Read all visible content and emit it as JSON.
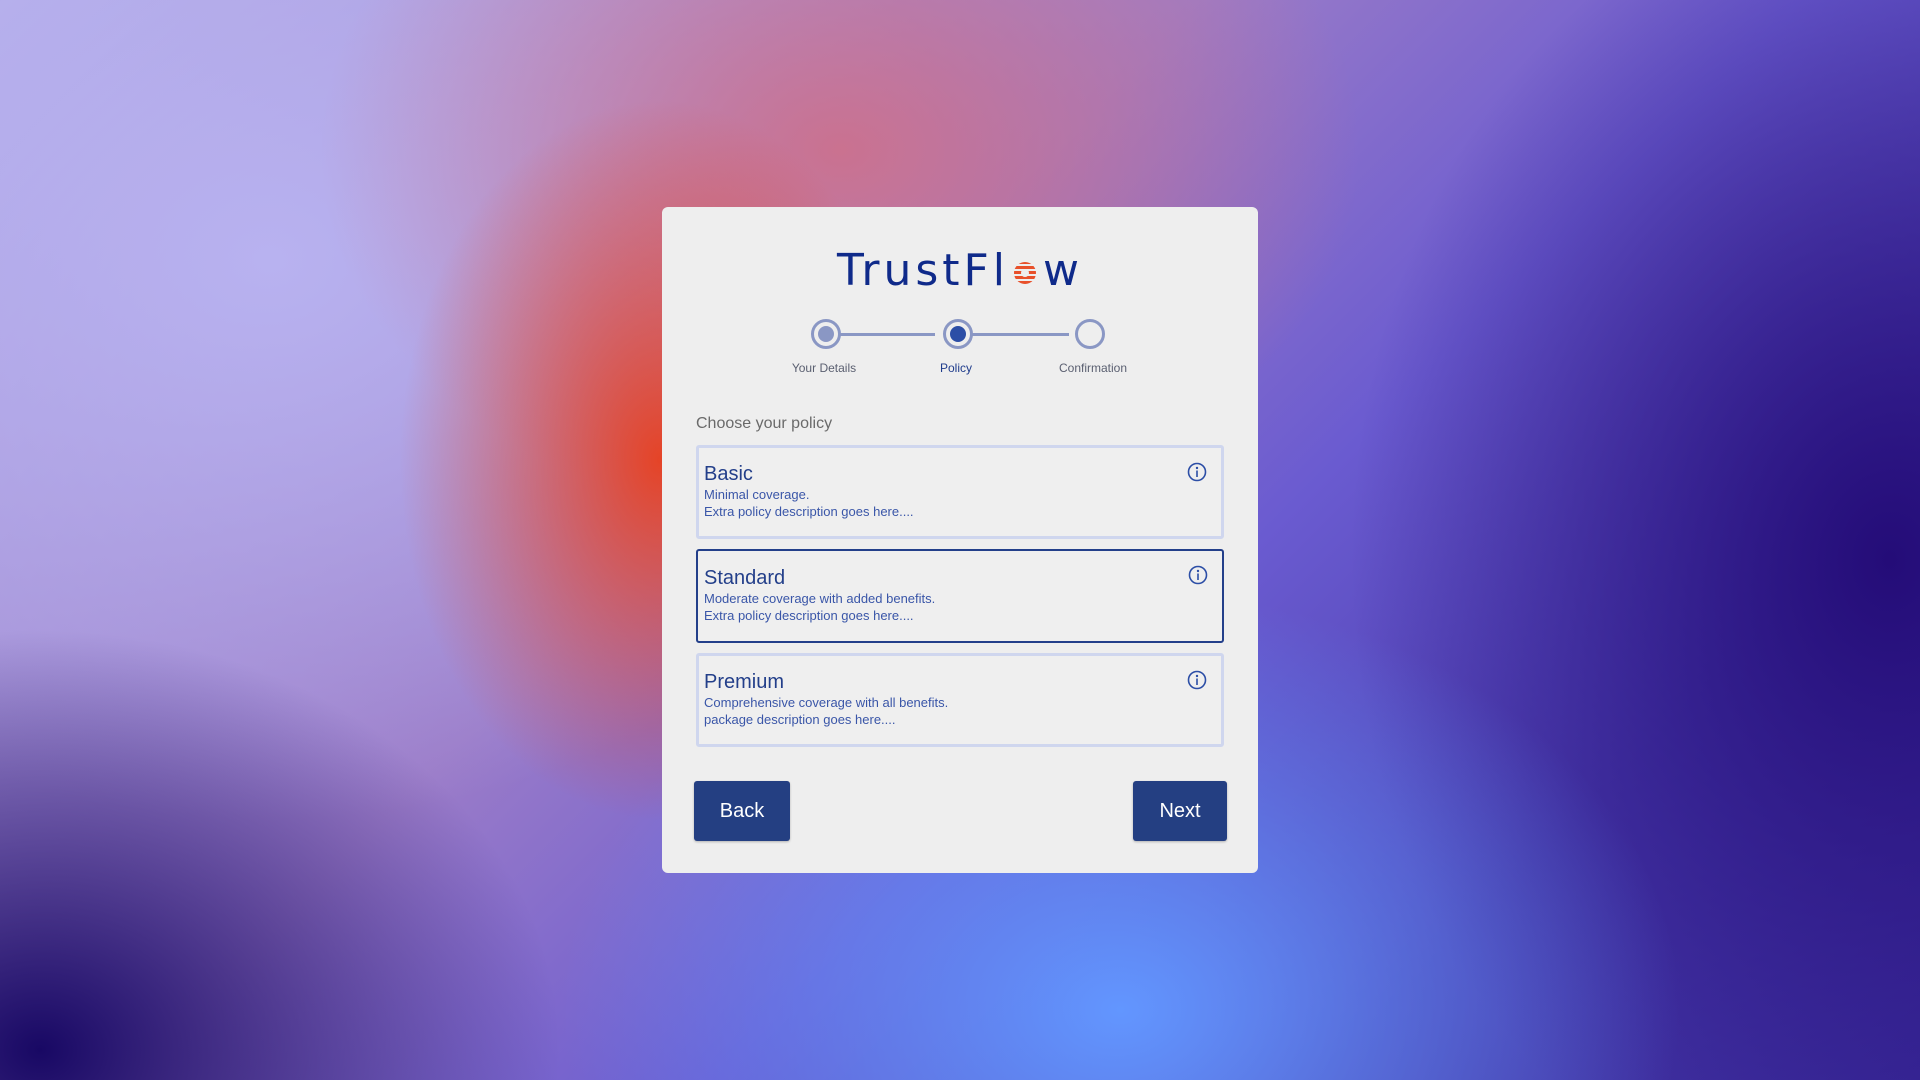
{
  "brand": {
    "before": "TrustFl",
    "after": "w",
    "mark_icon": "sunburst-o-icon",
    "mark_color": "#e8502a",
    "text_color": "#0f2a8a"
  },
  "stepper": {
    "steps": [
      {
        "label": "Your Details",
        "state": "completed"
      },
      {
        "label": "Policy",
        "state": "active"
      },
      {
        "label": "Confirmation",
        "state": "pending"
      }
    ],
    "completed_color": "#8a97c4",
    "active_color": "#2c4ea6"
  },
  "policy_section": {
    "title": "Choose your policy",
    "selected": "Standard",
    "options": [
      {
        "name": "Basic",
        "line1": "Minimal coverage.",
        "line2": "Extra policy description goes here....",
        "icon": "info-icon"
      },
      {
        "name": "Standard",
        "line1": "Moderate coverage with added benefits.",
        "line2": "Extra policy description goes here....",
        "icon": "info-icon"
      },
      {
        "name": "Premium",
        "line1": "Comprehensive coverage with all benefits.",
        "line2": "package description goes here....",
        "icon": "info-icon"
      }
    ]
  },
  "actions": {
    "back_label": "Back",
    "next_label": "Next",
    "button_color": "#243f82"
  }
}
